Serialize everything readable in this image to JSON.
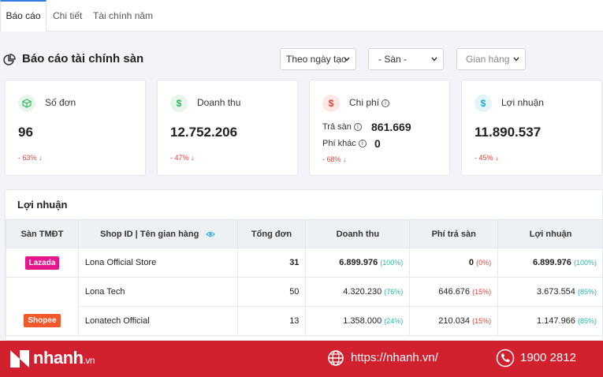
{
  "tabs": [
    {
      "label": "Báo cáo",
      "active": true
    },
    {
      "label": "Chi tiết",
      "active": false
    },
    {
      "label": "Tài chính năm",
      "active": false
    }
  ],
  "title": "Báo cáo tài chính sàn",
  "filters": {
    "date": "Theo ngày tạo",
    "platform": "- Sàn -",
    "shop": "Gian hàng"
  },
  "cards": {
    "orders": {
      "label": "Số đơn",
      "value": "96",
      "change": "- 63%"
    },
    "revenue": {
      "label": "Doanh thu",
      "value": "12.752.206",
      "change": "- 47%"
    },
    "cost": {
      "label": "Chi phí",
      "fee_label": "Trả sàn",
      "fee_value": "861.669",
      "other_label": "Phí khác",
      "other_value": "0",
      "change": "- 68%"
    },
    "profit": {
      "label": "Lợi nhuận",
      "value": "11.890.537",
      "change": "- 45%"
    }
  },
  "table": {
    "title": "Lợi nhuận",
    "headers": [
      "Sàn TMĐT",
      "Shop ID | Tên gian hàng",
      "Tổng đơn",
      "Doanh thu",
      "Phí trả sàn",
      "Lợi nhuận"
    ],
    "rows": [
      {
        "platform": "Lazada",
        "shop": "Lona Official Store",
        "orders": "31",
        "revenue": "6.899.976",
        "revenue_pct": "(100%)",
        "fee": "0",
        "fee_pct": "(0%)",
        "profit": "6.899.976",
        "profit_pct": "(100%)"
      },
      {
        "platform": "",
        "shop": "Lona Tech",
        "orders": "50",
        "revenue": "4.320.230",
        "revenue_pct": "(76%)",
        "fee": "646.676",
        "fee_pct": "(15%)",
        "profit": "3.673.554",
        "profit_pct": "(85%)"
      },
      {
        "platform": "Shopee",
        "shop": "Lonatech Official",
        "orders": "13",
        "revenue": "1.358.000",
        "revenue_pct": "(24%)",
        "fee": "210.034",
        "fee_pct": "(15%)",
        "profit": "1.147.966",
        "profit_pct": "(85%)"
      }
    ]
  },
  "footer": {
    "brand": "nhanh",
    "brand_suffix": ".vn",
    "url": "https://nhanh.vn/",
    "phone": "1900 2812"
  },
  "colors": {
    "lazada": "#e5168a",
    "shopee": "#f1582c",
    "footer": "#d2202e",
    "accent": "#2f7de1",
    "negative": "#e0443b",
    "positive": "#27b7a0"
  }
}
